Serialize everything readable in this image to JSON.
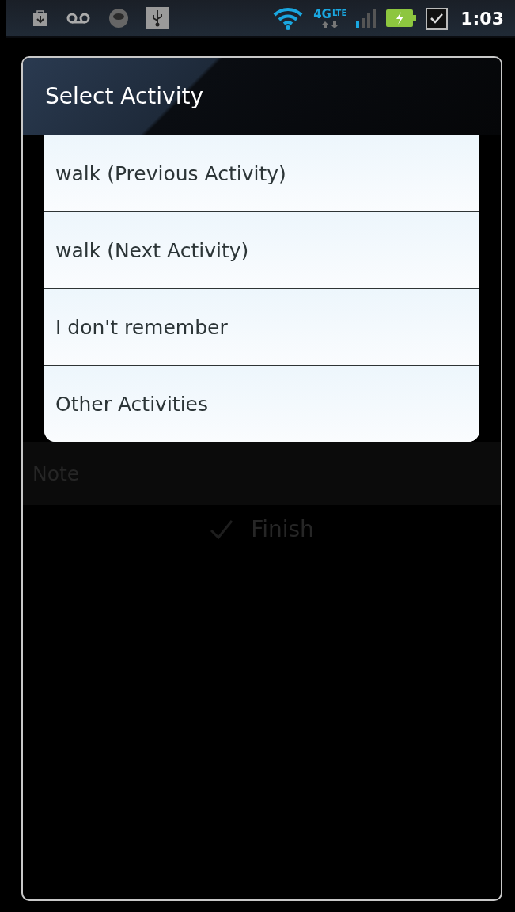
{
  "status_bar": {
    "network": "4G",
    "network_sub": "LTE",
    "time": "1:03"
  },
  "dialog": {
    "title": "Select Activity",
    "items": [
      {
        "label": "walk (Previous Activity)"
      },
      {
        "label": "walk (Next Activity)"
      },
      {
        "label": "I don't remember"
      },
      {
        "label": "Other Activities"
      }
    ]
  },
  "background": {
    "field_label": "Note",
    "button": "Finish"
  }
}
